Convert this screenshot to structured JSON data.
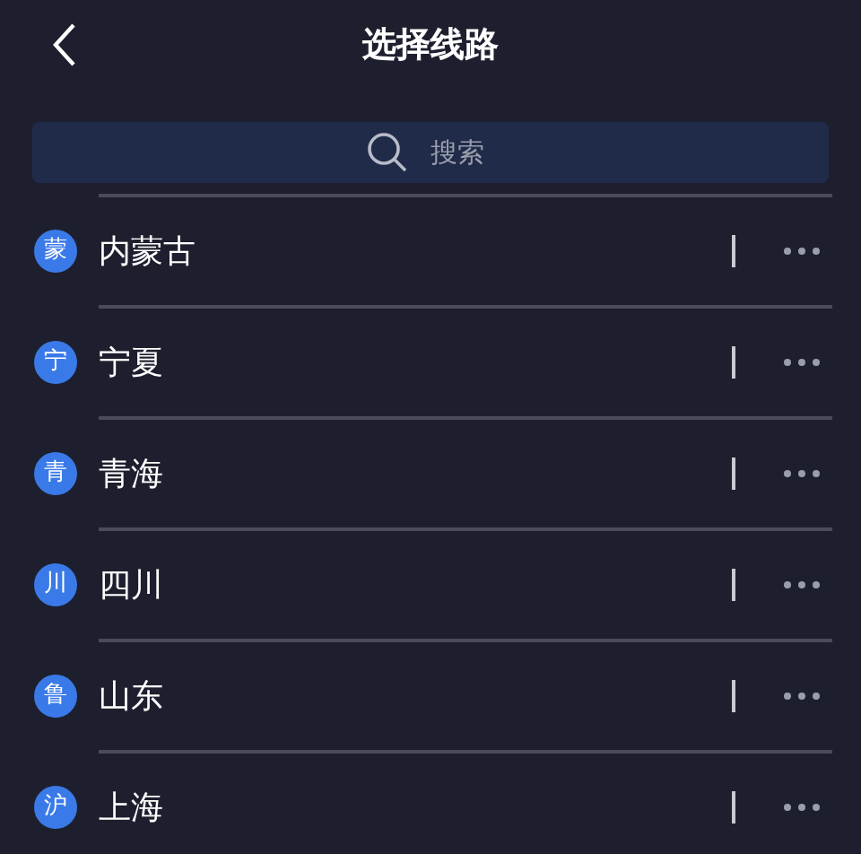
{
  "header": {
    "title": "选择线路"
  },
  "search": {
    "placeholder": "搜索"
  },
  "routes": [
    {
      "badge": "蒙",
      "name": "内蒙古"
    },
    {
      "badge": "宁",
      "name": "宁夏"
    },
    {
      "badge": "青",
      "name": "青海"
    },
    {
      "badge": "川",
      "name": "四川"
    },
    {
      "badge": "鲁",
      "name": "山东"
    },
    {
      "badge": "沪",
      "name": "上海"
    }
  ]
}
